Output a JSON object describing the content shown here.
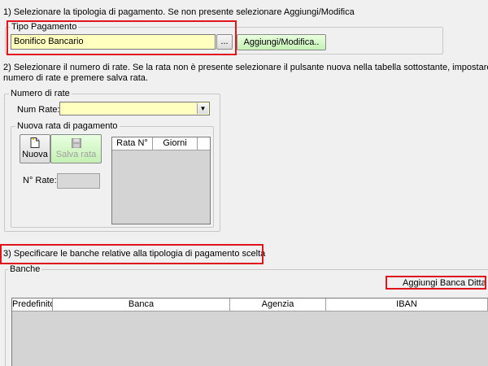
{
  "step1": {
    "instruction": "1) Selezionare la tipologia di pagamento. Se non presente selezionare Aggiungi/Modifica",
    "group_label": "Tipo Pagamento",
    "value": "Bonifico Bancario",
    "browse_label": "...",
    "add_modify_label": "Aggiungi/Modifica.."
  },
  "step2": {
    "instruction_line1": "2) Selezionare il numero di rate. Se la rata non è presente selezionare il pulsante nuova nella tabella sottostante, impostare il",
    "instruction_line2": "numero di rate e premere salva rata.",
    "group_label": "Numero di rate",
    "num_rate_label": "Num Rate:",
    "num_rate_value": "",
    "subgroup_label": "Nuova rata di pagamento",
    "new_label": "Nuova",
    "save_label": "Salva rata",
    "n_rate_label": "N° Rate:",
    "columns": [
      "Rata N°",
      "Giorni"
    ]
  },
  "step3": {
    "instruction": "3) Specificare le banche relative alla tipologia di pagamento scelta",
    "group_label": "Banche",
    "add_bank_label": "Aggiungi Banca Ditta",
    "columns": [
      "Predefinito",
      "Banca",
      "Agenzia",
      "IBAN"
    ]
  },
  "colors": {
    "highlight_red": "#e0141c",
    "field_yellow": "#ffffc0",
    "button_green": "#c4f0b4"
  }
}
